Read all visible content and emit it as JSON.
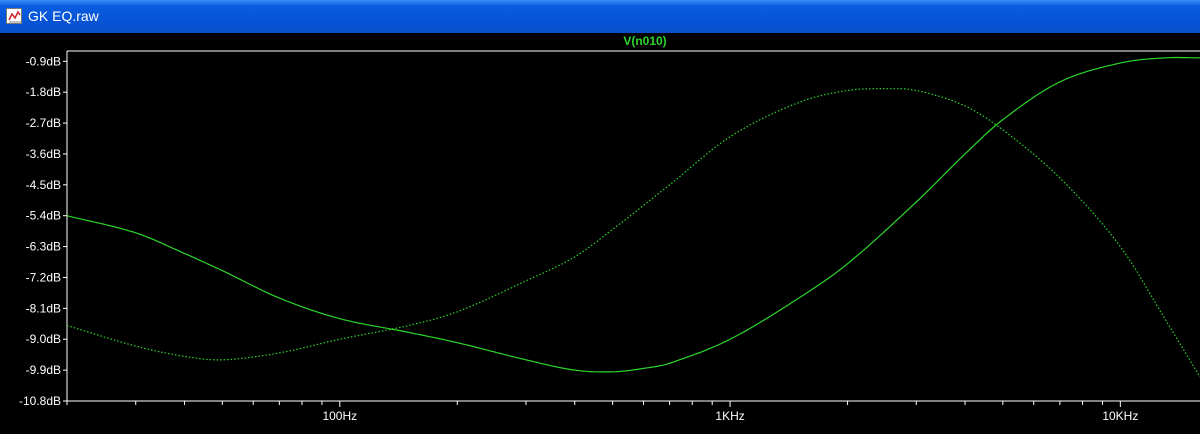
{
  "window": {
    "title": "GK EQ.raw",
    "icon": "waveform-icon"
  },
  "colors": {
    "background": "#000000",
    "trace": "#2cd62c",
    "axis": "#ffffff",
    "titlebar": "#0654d8"
  },
  "chart_data": {
    "type": "line",
    "title": "V(n010)",
    "xlabel": "",
    "ylabel": "",
    "x_scale": "log",
    "xlim": [
      20,
      16000
    ],
    "ylim": [
      -10.8,
      -0.6
    ],
    "x_ticks": [
      {
        "value": 100,
        "label": "100Hz"
      },
      {
        "value": 1000,
        "label": "1KHz"
      },
      {
        "value": 10000,
        "label": "10KHz"
      }
    ],
    "y_ticks": [
      {
        "value": -0.9,
        "label": "-0.9dB"
      },
      {
        "value": -1.8,
        "label": "-1.8dB"
      },
      {
        "value": -2.7,
        "label": "-2.7dB"
      },
      {
        "value": -3.6,
        "label": "-3.6dB"
      },
      {
        "value": -4.5,
        "label": "-4.5dB"
      },
      {
        "value": -5.4,
        "label": "-5.4dB"
      },
      {
        "value": -6.3,
        "label": "-6.3dB"
      },
      {
        "value": -7.2,
        "label": "-7.2dB"
      },
      {
        "value": -8.1,
        "label": "-8.1dB"
      },
      {
        "value": -9.0,
        "label": "-9.0dB"
      },
      {
        "value": -9.9,
        "label": "-9.9dB"
      },
      {
        "value": -10.8,
        "label": "-10.8dB"
      }
    ],
    "grid": false,
    "series": [
      {
        "style": "solid",
        "x": [
          20,
          30,
          40,
          50,
          70,
          100,
          150,
          200,
          300,
          400,
          500,
          600,
          700,
          1000,
          1500,
          2000,
          3000,
          4000,
          5000,
          7000,
          10000,
          13000,
          16000
        ],
        "y": [
          -5.4,
          -5.9,
          -6.5,
          -7.0,
          -7.8,
          -8.4,
          -8.8,
          -9.1,
          -9.6,
          -9.9,
          -9.95,
          -9.85,
          -9.7,
          -9.0,
          -7.8,
          -6.8,
          -5.0,
          -3.6,
          -2.6,
          -1.5,
          -0.95,
          -0.8,
          -0.8
        ]
      },
      {
        "style": "dotted",
        "x": [
          20,
          30,
          40,
          50,
          70,
          100,
          150,
          200,
          300,
          400,
          500,
          700,
          1000,
          1500,
          2000,
          2500,
          3000,
          4000,
          5000,
          7000,
          10000,
          13000,
          16000
        ],
        "y": [
          -8.6,
          -9.2,
          -9.5,
          -9.6,
          -9.4,
          -9.0,
          -8.6,
          -8.2,
          -7.3,
          -6.6,
          -5.8,
          -4.5,
          -3.1,
          -2.1,
          -1.75,
          -1.7,
          -1.75,
          -2.2,
          -2.9,
          -4.3,
          -6.3,
          -8.4,
          -10.1
        ]
      }
    ]
  }
}
